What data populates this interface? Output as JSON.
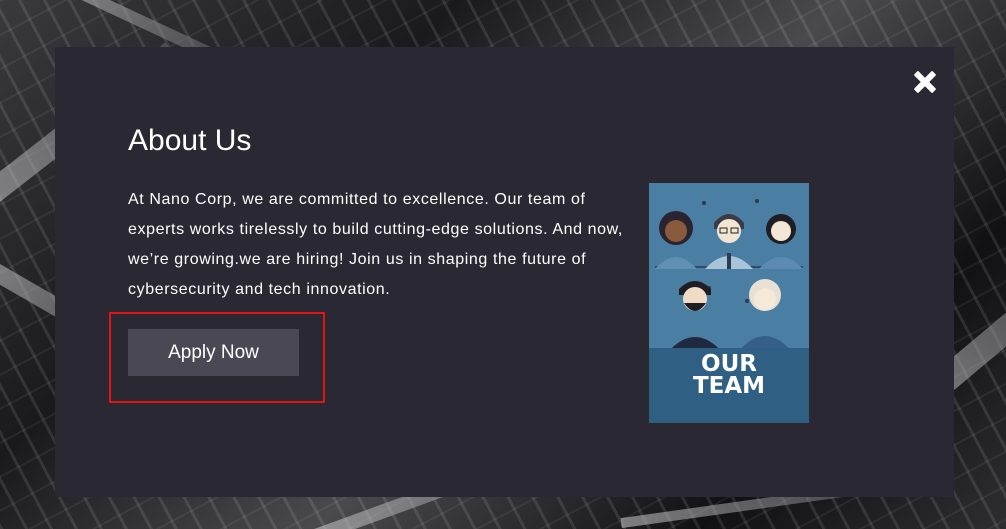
{
  "modal": {
    "title": "About Us",
    "description": "At Nano Corp, we are committed to excellence. Our team of experts works tirelessly to build cutting-edge solutions. And now, we’re growing.we are hiring! Join us in shaping the future of cybersecurity and tech innovation.",
    "apply_label": "Apply Now",
    "close_icon": "close-icon",
    "image": {
      "caption_line1": "OUR",
      "caption_line2": "TEAM"
    }
  },
  "colors": {
    "modal_bg": "#2a2832",
    "button_bg": "#4a4854",
    "highlight": "#e31414",
    "image_bg": "#3e6f93"
  }
}
